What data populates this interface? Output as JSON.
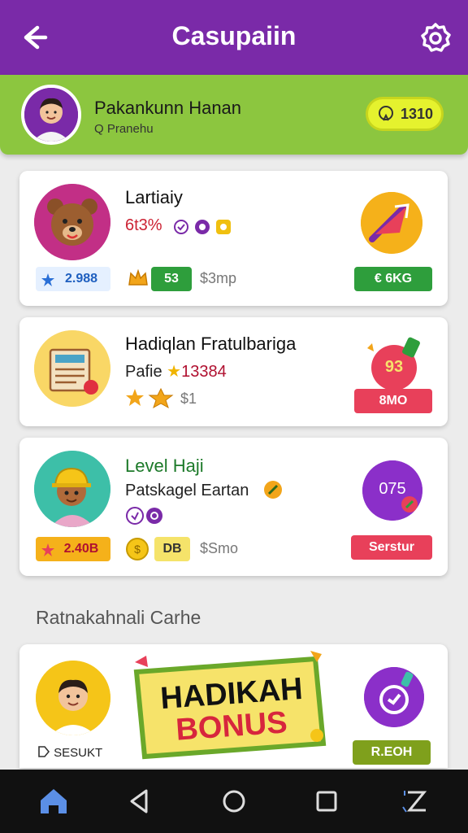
{
  "app": {
    "title": "Casupaiin"
  },
  "profile": {
    "name": "Pakankunn Hanan",
    "subtitle": "Q Pranehu",
    "points": "1310"
  },
  "cards": [
    {
      "title": "Lartiaiy",
      "line2": "6t3%",
      "rating": "2.988",
      "chip_value": "53",
      "muted": "$3mp",
      "action": "€ 6KG"
    },
    {
      "title": "Hadiqlan Fratulbariga",
      "line2_prefix": "Pafie",
      "line2_value": "13384",
      "muted": "$1",
      "badge_value": "93",
      "action": "8MO"
    },
    {
      "title": "Level Haji",
      "line2": "Patskagel Eartan",
      "rating": "2.40B",
      "chip_value": "DB",
      "muted": "$Smo",
      "badge_value": "075",
      "action": "Serstur"
    },
    {
      "avatar_label": "SESUKT",
      "banner_line1": "HADIKAH",
      "banner_line2": "BONUS",
      "action": "R.EOH"
    }
  ],
  "section": {
    "title": "Ratnakahnali Carhe"
  },
  "colors": {
    "purple": "#7a2aa8",
    "green": "#8cc63f",
    "yellow": "#e5f22e",
    "action_green": "#2e9e3c",
    "action_red": "#e8405a",
    "olive": "#7fa01c"
  },
  "icons": {
    "back": "arrow-left-icon",
    "settings": "gear-icon",
    "nav": [
      "home-icon",
      "back-triangle-icon",
      "home-circle-icon",
      "recents-square-icon",
      "assistant-icon"
    ]
  }
}
